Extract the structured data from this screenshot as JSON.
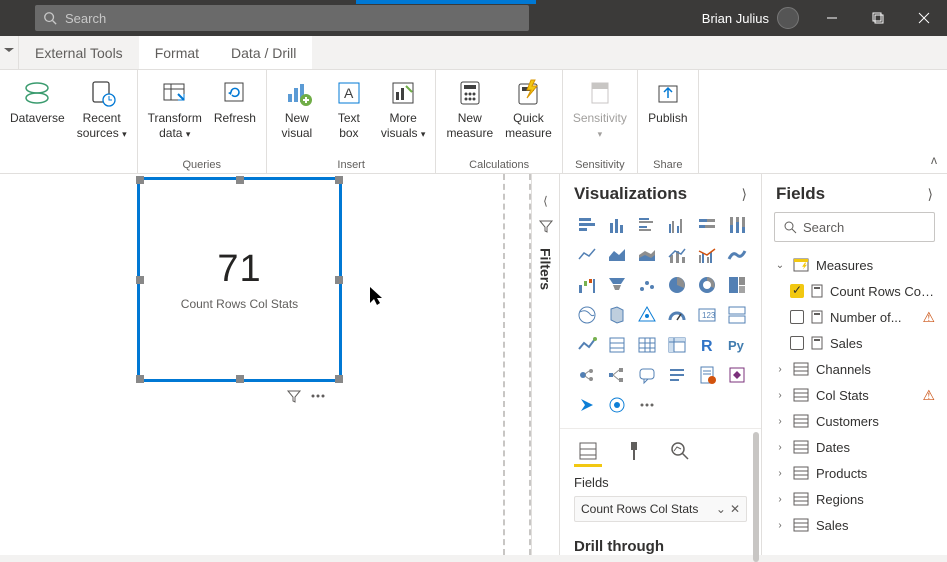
{
  "titlebar": {
    "search_placeholder": "Search",
    "user_name": "Brian Julius"
  },
  "tabs": {
    "external_tools": "External Tools",
    "format": "Format",
    "data_drill": "Data / Drill"
  },
  "ribbon": {
    "dataverse": "Dataverse",
    "recent_sources": "Recent",
    "recent_sources_2": "sources",
    "transform": "Transform",
    "transform_2": "data",
    "refresh": "Refresh",
    "new_visual": "New",
    "new_visual_2": "visual",
    "text_box": "Text",
    "text_box_2": "box",
    "more_visuals": "More",
    "more_visuals_2": "visuals",
    "new_measure": "New",
    "new_measure_2": "measure",
    "quick_measure": "Quick",
    "quick_measure_2": "measure",
    "sensitivity": "Sensitivity",
    "publish": "Publish",
    "groups": {
      "queries": "Queries",
      "insert": "Insert",
      "calculations": "Calculations",
      "sensitivity": "Sensitivity",
      "share": "Share"
    }
  },
  "card": {
    "value": "71",
    "label": "Count Rows Col Stats"
  },
  "viz_pane": {
    "title": "Visualizations",
    "fields_label": "Fields",
    "well_item": "Count Rows Col Stats",
    "drill_label": "Drill through"
  },
  "filters_tab": "Filters",
  "fields_pane": {
    "title": "Fields",
    "search_placeholder": "Search",
    "measures_table": "Measures",
    "leaves": {
      "count_rows": "Count Rows Col ...",
      "number_of": "Number of...",
      "sales": "Sales"
    },
    "tables": [
      "Channels",
      "Col Stats",
      "Customers",
      "Dates",
      "Products",
      "Regions",
      "Sales"
    ]
  }
}
